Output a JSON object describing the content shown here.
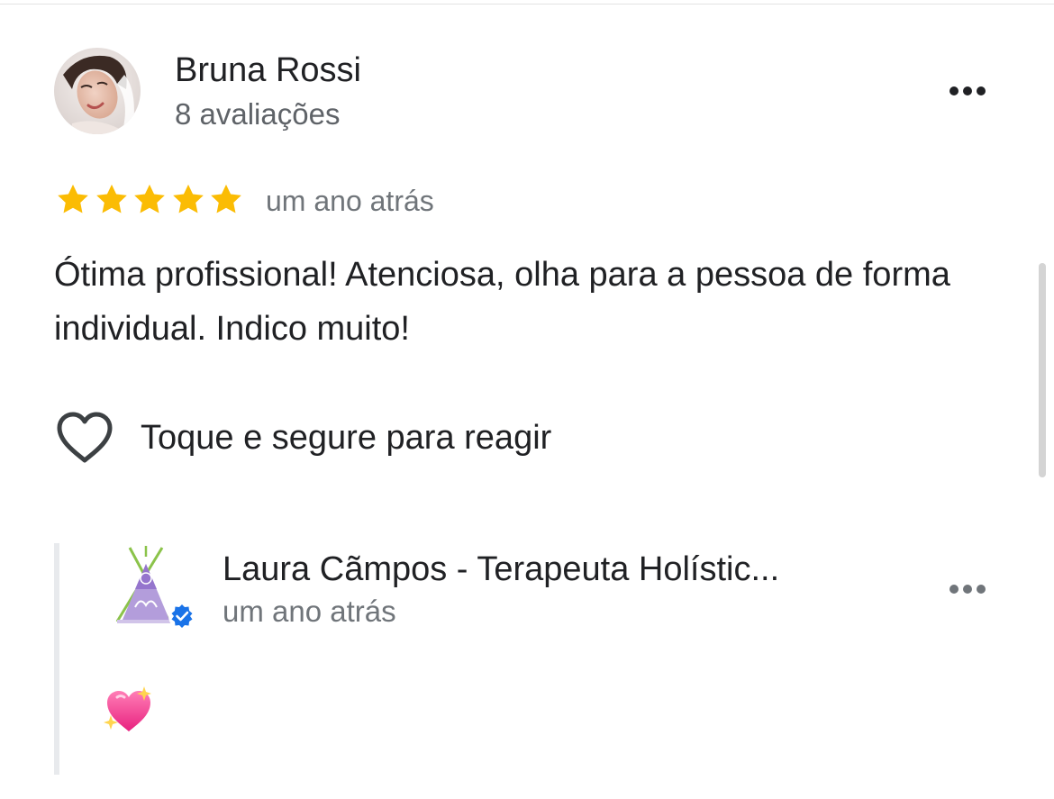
{
  "review": {
    "reviewer_name": "Bruna Rossi",
    "reviewer_reviews_count": "8 avaliações",
    "rating": 5,
    "rating_max": 5,
    "time": "um ano atrás",
    "text": "Ótima profissional! Atenciosa, olha para a pessoa de forma individual. Indico muito!",
    "react_label": "Toque e segure para reagir",
    "more_icon": "more-horiz-icon"
  },
  "reply": {
    "owner_name": "Laura Cãmpos - Terapeuta Holístic...",
    "time": "um ano atrás",
    "verified": true,
    "text_emoji": "sparkling-heart-icon",
    "more_icon": "more-horiz-icon"
  },
  "colors": {
    "star": "#fbbc04",
    "verified_badge": "#1a73e8",
    "secondary_text": "#70757a",
    "primary_text": "#202124",
    "reply_bar": "#e8eaed"
  }
}
